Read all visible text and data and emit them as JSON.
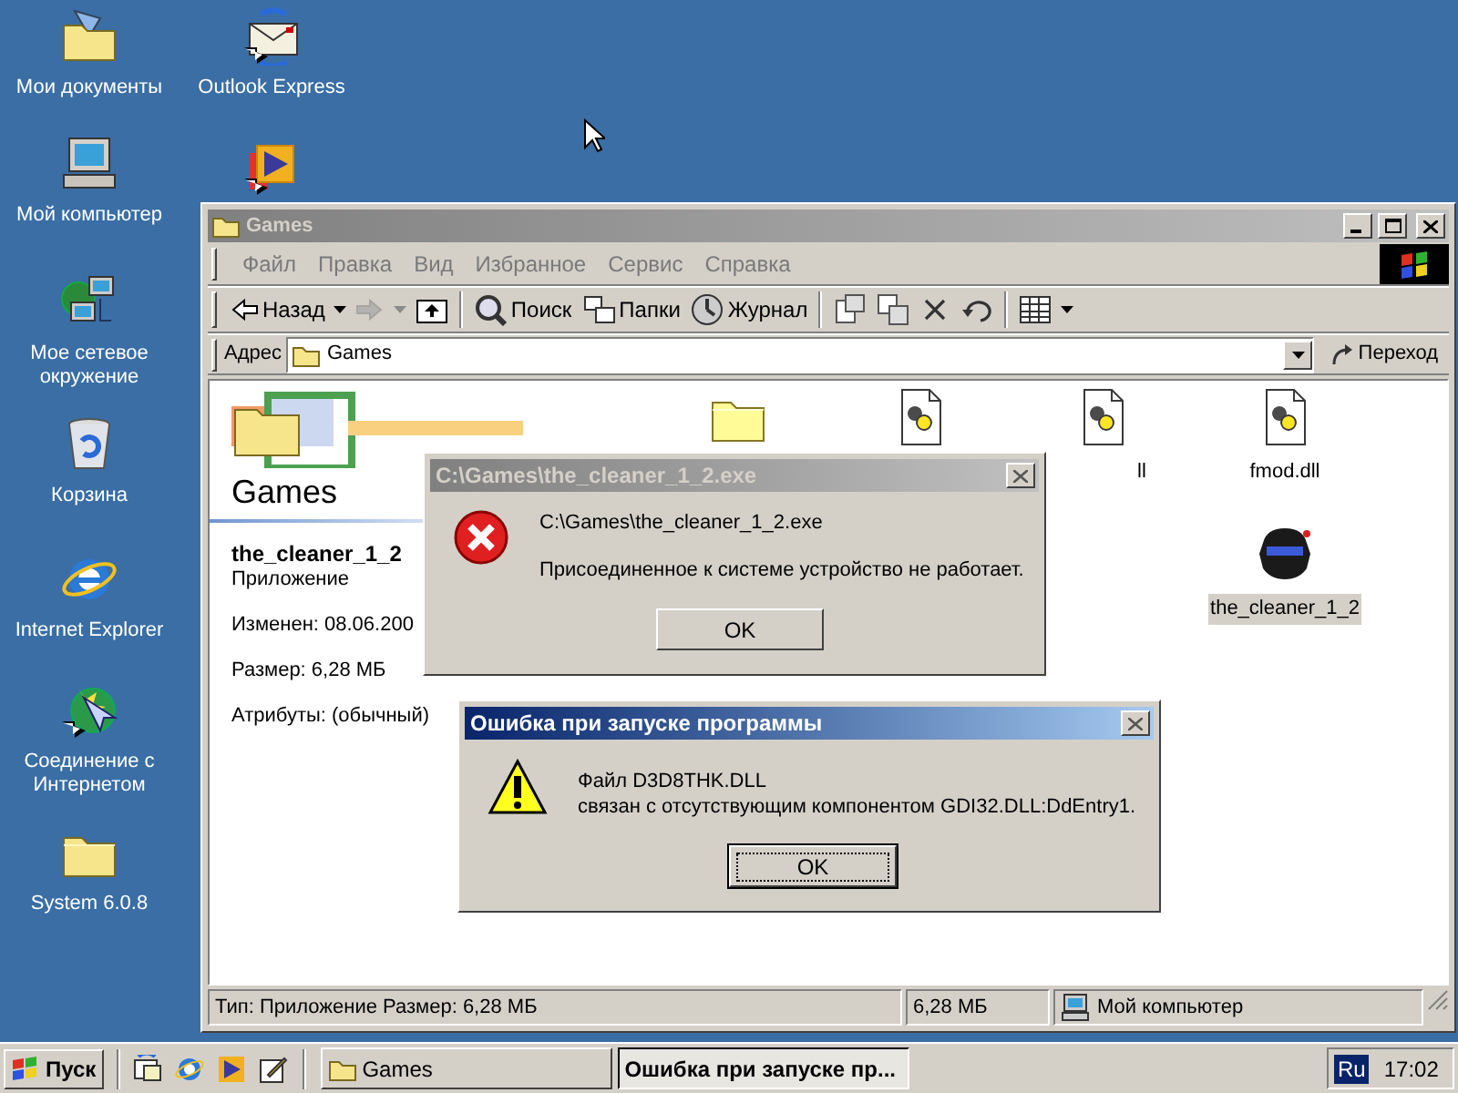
{
  "desktop": {
    "icons": [
      {
        "kind": "documents",
        "label": "Мои документы"
      },
      {
        "kind": "computer",
        "label": "Мой компьютер"
      },
      {
        "kind": "network",
        "label": "Мое сетевое окружение"
      },
      {
        "kind": "recycle",
        "label": "Корзина"
      },
      {
        "kind": "ie",
        "label": "Internet Explorer"
      },
      {
        "kind": "connect",
        "label": "Соединение с Интернетом"
      },
      {
        "kind": "folder",
        "label": "System 6.0.8"
      },
      {
        "kind": "outlook",
        "label": "Outlook Express"
      },
      {
        "kind": "media"
      }
    ]
  },
  "explorer": {
    "title": "Games",
    "active": false,
    "menu": [
      "Файл",
      "Правка",
      "Вид",
      "Избранное",
      "Сервис",
      "Справка"
    ],
    "toolbar": [
      {
        "kind": "back",
        "label": "Назад",
        "disabled": false
      },
      {
        "kind": "forward",
        "disabled": true
      },
      {
        "kind": "up",
        "disabled": false
      },
      {
        "kind": "separator"
      },
      {
        "kind": "search",
        "label": "Поиск",
        "disabled": false
      },
      {
        "kind": "folders",
        "label": "Папки",
        "disabled": false
      },
      {
        "kind": "history",
        "label": "Журнал",
        "disabled": false
      },
      {
        "kind": "separator"
      },
      {
        "kind": "moveto",
        "disabled": false
      },
      {
        "kind": "copyto",
        "disabled": false
      },
      {
        "kind": "delete",
        "disabled": false
      },
      {
        "kind": "undo",
        "disabled": false
      },
      {
        "kind": "separator"
      },
      {
        "kind": "views",
        "disabled": false
      }
    ],
    "address": {
      "label": "Адрес",
      "value": "Games",
      "go": "Переход"
    },
    "info_pane": {
      "heading": "Games",
      "name": "the_cleaner_1_2",
      "type": "Приложение",
      "details": [
        "Изменен: 08.06.200",
        "Размер: 6,28 МБ",
        "Атрибуты: (обычный)"
      ]
    },
    "files": [
      {
        "kind": "folder",
        "selected": false
      },
      {
        "kind": "dll",
        "selected": false
      },
      {
        "kind": "dll",
        "label": "ll",
        "label_cut": true,
        "selected": false
      },
      {
        "kind": "dll",
        "label": "fmod.dll",
        "selected": false
      },
      {
        "kind": "cleaner",
        "label": "the_cleaner_1_2",
        "selected": true
      }
    ],
    "status_bar": [
      "Тип: Приложение Размер: 6,28 МБ",
      "6,28 МБ",
      "Мой компьютер"
    ]
  },
  "dialogs": [
    {
      "title": "C:\\Games\\the_cleaner_1_2.exe",
      "active": false,
      "kind": "error",
      "lines": [
        "C:\\Games\\the_cleaner_1_2.exe",
        "Присоединенное к системе устройство не работает."
      ],
      "button": "OK",
      "focused": false
    },
    {
      "title": "Ошибка при запуске программы",
      "active": true,
      "kind": "warning",
      "lines": [
        "Файл D3D8THK.DLL",
        "связан с отсутствующим компонентом GDI32.DLL:DdEntry1."
      ],
      "button": "OK",
      "focused": true
    }
  ],
  "taskbar": {
    "start": "Пуск",
    "quick_launch": [
      {
        "kind": "desktop"
      },
      {
        "kind": "ie"
      },
      {
        "kind": "media"
      },
      {
        "kind": "notepad"
      }
    ],
    "tasks": [
      {
        "label": "Games",
        "selected": false
      },
      {
        "label": "Ошибка при запуске пр...",
        "selected": true
      }
    ],
    "language": "Ru",
    "clock": "17:02"
  }
}
